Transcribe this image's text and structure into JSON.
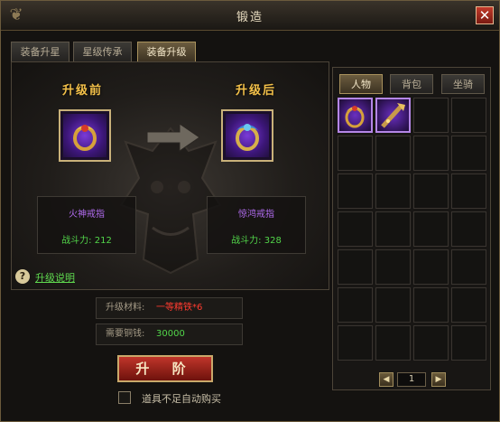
{
  "window": {
    "title": "锻造"
  },
  "tabs": [
    {
      "label": "装备升星"
    },
    {
      "label": "星级传承"
    },
    {
      "label": "装备升级"
    }
  ],
  "upgrade": {
    "before_label": "升级前",
    "after_label": "升级后",
    "before_item": {
      "name": "火神戒指",
      "power": "战斗力: 212",
      "name_color": "#b26cf0"
    },
    "after_item": {
      "name": "惊鸿戒指",
      "power": "战斗力: 328",
      "name_color": "#b26cf0"
    },
    "help_text": "升级说明"
  },
  "materials": {
    "label": "升级材料:",
    "value": "一等精铁*6",
    "value_color": "#ff3b2f"
  },
  "cost": {
    "label": "需要铜钱:",
    "value": "30000",
    "value_color": "#52d64a"
  },
  "upgrade_button": {
    "label": "升 阶"
  },
  "auto_buy": {
    "label": "道具不足自动购买",
    "checked": false
  },
  "bag": {
    "tabs": [
      {
        "label": "人物"
      },
      {
        "label": "背包"
      },
      {
        "label": "坐骑"
      }
    ],
    "active_tab": "人物",
    "page": "1",
    "items": [
      {
        "icon": "ring-icon"
      },
      {
        "icon": "staff-icon"
      }
    ]
  }
}
